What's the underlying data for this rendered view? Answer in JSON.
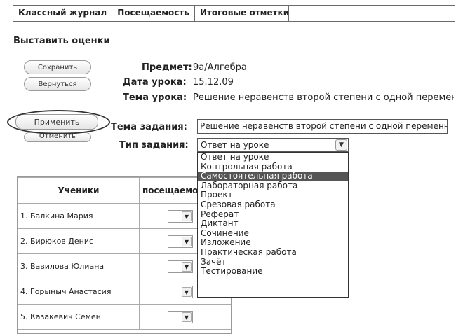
{
  "tabs": [
    "Классный журнал",
    "Посещаемость",
    "Итоговые отметки"
  ],
  "heading": "Выставить оценки",
  "buttons": {
    "save": "Сохранить",
    "back": "Вернуться",
    "apply": "Применить",
    "cancel": "Отменить"
  },
  "lesson": {
    "subject_label": "Предмет:",
    "subject_value": "9а/Алгебра",
    "date_label": "Дата урока:",
    "date_value": "15.12.09",
    "topic_label": "Тема урока:",
    "topic_value": "Решение неравенств второй степени с одной переменной"
  },
  "task": {
    "topic_label": "Тема задания:",
    "topic_value": "Решение неравенств второй степени с одной переменной",
    "type_label": "Тип задания:",
    "type_selected": "Ответ на уроке",
    "options": [
      "Ответ на уроке",
      "Контрольная работа",
      "Самостоятельная работа",
      "Лабораторная работа",
      "Проект",
      "Срезовая работа",
      "Реферат",
      "Диктант",
      "Сочинение",
      "Изложение",
      "Практическая работа",
      "Зачёт",
      "Тестирование"
    ],
    "highlighted_option": "Самостоятельная работа"
  },
  "table": {
    "headers": [
      "Ученики",
      "посещаемость"
    ],
    "students": [
      "1. Балкина Мария",
      "2. Бирюков Денис",
      "3. Вавилова Юлиана",
      "4. Горыныч Анастасия",
      "5. Казакевич Семён"
    ]
  },
  "colors": {
    "highlight": "#555555",
    "border": "#6b6b6b"
  }
}
